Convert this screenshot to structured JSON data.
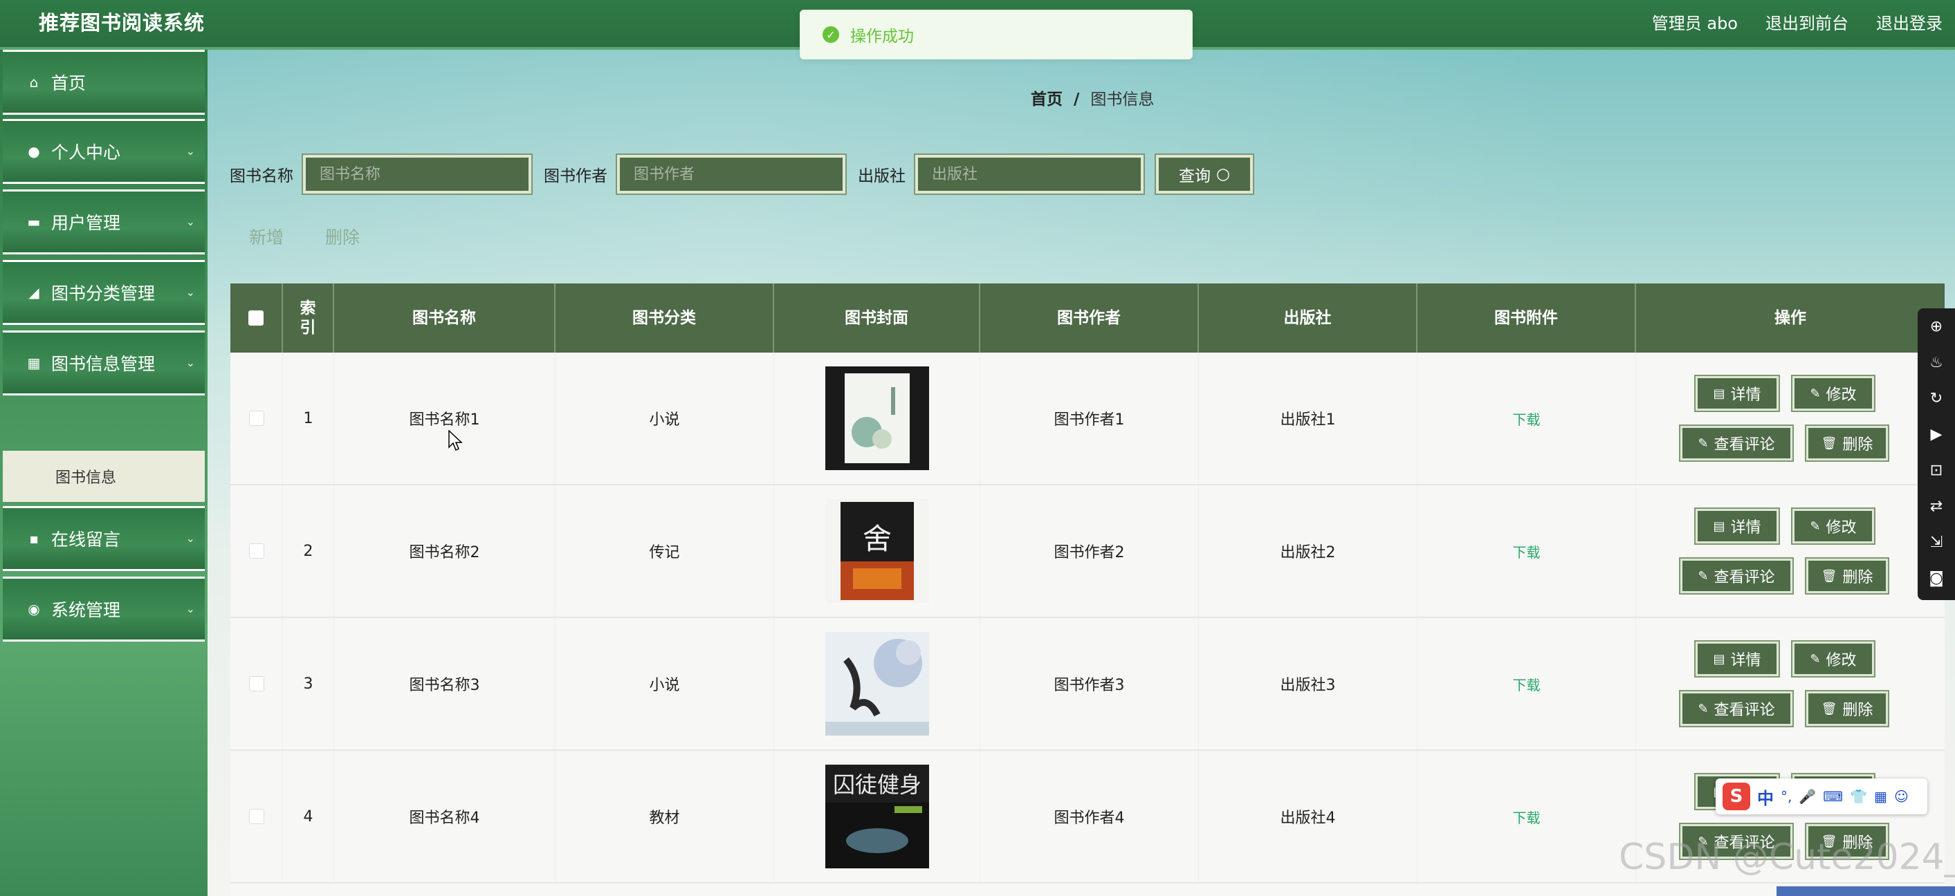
{
  "app": {
    "title": "推荐图书阅读系统"
  },
  "header": {
    "admin_label": "管理员 abo",
    "back_to_front": "退出到前台",
    "logout": "退出登录"
  },
  "toast": {
    "message": "操作成功",
    "color": "#67c23a"
  },
  "sidebar": {
    "items": [
      {
        "label": "首页",
        "icon": "home-icon"
      },
      {
        "label": "个人中心",
        "icon": "user-icon"
      },
      {
        "label": "用户管理",
        "icon": "users-icon"
      },
      {
        "label": "图书分类管理",
        "icon": "category-icon"
      },
      {
        "label": "图书信息管理",
        "icon": "grid-icon"
      },
      {
        "label": "在线留言",
        "icon": "message-icon"
      },
      {
        "label": "系统管理",
        "icon": "settings-icon"
      }
    ],
    "active_sub": "图书信息"
  },
  "breadcrumb": {
    "home": "首页",
    "separator": "/",
    "current": "图书信息"
  },
  "search": {
    "name_label": "图书名称",
    "name_placeholder": "图书名称",
    "author_label": "图书作者",
    "author_placeholder": "图书作者",
    "publisher_label": "出版社",
    "publisher_placeholder": "出版社",
    "query_button": "查询"
  },
  "actions": {
    "add": "新增",
    "delete": "删除"
  },
  "table": {
    "headers": [
      "索引",
      "图书名称",
      "图书分类",
      "图书封面",
      "图书作者",
      "出版社",
      "图书附件",
      "操作"
    ],
    "rows": [
      {
        "index": "1",
        "name": "图书名称1",
        "category": "小说",
        "author": "图书作者1",
        "publisher": "出版社1",
        "attachment": "下载"
      },
      {
        "index": "2",
        "name": "图书名称2",
        "category": "传记",
        "author": "图书作者2",
        "publisher": "出版社2",
        "attachment": "下载"
      },
      {
        "index": "3",
        "name": "图书名称3",
        "category": "小说",
        "author": "图书作者3",
        "publisher": "出版社3",
        "attachment": "下载"
      },
      {
        "index": "4",
        "name": "图书名称4",
        "category": "教材",
        "author": "图书作者4",
        "publisher": "出版社4",
        "attachment": "下载"
      }
    ],
    "row_buttons": {
      "detail": "详情",
      "edit": "修改",
      "comments": "查看评论",
      "delete": "删除"
    }
  },
  "colors": {
    "brand": "#2f7a46",
    "button": "#4e6a47",
    "download": "#2aa86b"
  },
  "ime": {
    "brand": "S",
    "lang": "中"
  },
  "watermark": "CSDN @Cute2024_"
}
